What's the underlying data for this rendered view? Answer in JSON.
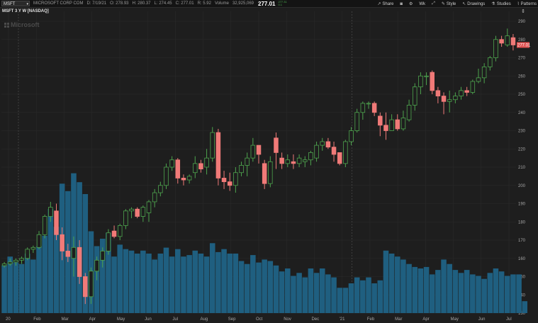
{
  "toolbar": {
    "symbol": "MSFT",
    "company": "MICROSOFT CORP COM",
    "date": "D: 7/19/21",
    "open": "O: 278.93",
    "high": "H: 280.37",
    "low": "L: 274.45",
    "close": "C: 277.01",
    "range": "R: 5.92",
    "volume_label": "Volume",
    "volume": "32,925,069",
    "last_price": "277.01",
    "change_top": "277.31",
    "change_bottom": "0.1",
    "buttons": [
      {
        "label": "Share",
        "icon": "share-icon"
      },
      {
        "label": "",
        "icon": "camera-icon"
      },
      {
        "label": "",
        "icon": "gear-icon"
      },
      {
        "label": "Wk",
        "icon": ""
      },
      {
        "label": "",
        "icon": "fullscreen-icon"
      },
      {
        "label": "Style",
        "icon": "paintbrush-icon"
      },
      {
        "label": "Drawings",
        "icon": "pencil-icon"
      },
      {
        "label": "Studies",
        "icon": "flask-icon"
      },
      {
        "label": "Patterns",
        "icon": "pattern-icon"
      }
    ]
  },
  "chart_title": "MSFT 3 Y W [NASDAQ]",
  "watermark": "Microsoft",
  "colors": {
    "up": "#4ea44e",
    "down": "#f07a78",
    "volume": "#1f5f80",
    "grid": "#2a2a2a",
    "background": "#1e1e1e",
    "price_badge": "#e05050"
  },
  "chart_data": {
    "type": "candlestick",
    "title": "MSFT 3 Y W [NASDAQ]",
    "price_axis": {
      "min": 130,
      "max": 290,
      "ticks": [
        130,
        140,
        150,
        160,
        170,
        180,
        190,
        200,
        210,
        220,
        230,
        240,
        250,
        260,
        270,
        280,
        290
      ]
    },
    "current_price_label": "277.01",
    "x_tick_labels": [
      "20",
      "Feb",
      "Mar",
      "Apr",
      "May",
      "Jun",
      "Jul",
      "Aug",
      "Sep",
      "Oct",
      "Nov",
      "Dec",
      "'21",
      "Feb",
      "Mar",
      "Apr",
      "May",
      "Jun",
      "Jul"
    ],
    "candles": [
      {
        "o": 156,
        "h": 158,
        "l": 155,
        "c": 157
      },
      {
        "o": 157,
        "h": 160,
        "l": 156,
        "c": 158
      },
      {
        "o": 158,
        "h": 160,
        "l": 156,
        "c": 159
      },
      {
        "o": 159,
        "h": 161,
        "l": 157,
        "c": 160
      },
      {
        "o": 160,
        "h": 166,
        "l": 159,
        "c": 165
      },
      {
        "o": 165,
        "h": 167,
        "l": 163,
        "c": 166
      },
      {
        "o": 166,
        "h": 175,
        "l": 165,
        "c": 173
      },
      {
        "o": 173,
        "h": 184,
        "l": 171,
        "c": 183
      },
      {
        "o": 183,
        "h": 191,
        "l": 180,
        "c": 188
      },
      {
        "o": 186,
        "h": 190,
        "l": 170,
        "c": 173
      },
      {
        "o": 173,
        "h": 177,
        "l": 159,
        "c": 164
      },
      {
        "o": 164,
        "h": 168,
        "l": 158,
        "c": 161
      },
      {
        "o": 160,
        "h": 172,
        "l": 150,
        "c": 166
      },
      {
        "o": 166,
        "h": 170,
        "l": 146,
        "c": 150
      },
      {
        "o": 150,
        "h": 152,
        "l": 135,
        "c": 139
      },
      {
        "o": 139,
        "h": 155,
        "l": 135,
        "c": 153
      },
      {
        "o": 153,
        "h": 161,
        "l": 148,
        "c": 159
      },
      {
        "o": 159,
        "h": 166,
        "l": 155,
        "c": 164
      },
      {
        "o": 164,
        "h": 176,
        "l": 162,
        "c": 174
      },
      {
        "o": 175,
        "h": 178,
        "l": 171,
        "c": 172
      },
      {
        "o": 172,
        "h": 179,
        "l": 170,
        "c": 178
      },
      {
        "o": 178,
        "h": 187,
        "l": 176,
        "c": 186
      },
      {
        "o": 186,
        "h": 188,
        "l": 182,
        "c": 187
      },
      {
        "o": 187,
        "h": 188,
        "l": 182,
        "c": 183
      },
      {
        "o": 183,
        "h": 189,
        "l": 180,
        "c": 188
      },
      {
        "o": 185,
        "h": 192,
        "l": 180,
        "c": 191
      },
      {
        "o": 191,
        "h": 198,
        "l": 188,
        "c": 196
      },
      {
        "o": 196,
        "h": 202,
        "l": 194,
        "c": 200
      },
      {
        "o": 200,
        "h": 212,
        "l": 198,
        "c": 210
      },
      {
        "o": 210,
        "h": 216,
        "l": 208,
        "c": 214
      },
      {
        "o": 214,
        "h": 215,
        "l": 201,
        "c": 204
      },
      {
        "o": 204,
        "h": 206,
        "l": 200,
        "c": 203
      },
      {
        "o": 203,
        "h": 206,
        "l": 201,
        "c": 205
      },
      {
        "o": 207,
        "h": 216,
        "l": 204,
        "c": 212
      },
      {
        "o": 212,
        "h": 214,
        "l": 207,
        "c": 209
      },
      {
        "o": 210,
        "h": 220,
        "l": 206,
        "c": 215
      },
      {
        "o": 215,
        "h": 232,
        "l": 213,
        "c": 229
      },
      {
        "o": 229,
        "h": 231,
        "l": 200,
        "c": 204
      },
      {
        "o": 204,
        "h": 208,
        "l": 198,
        "c": 202
      },
      {
        "o": 202,
        "h": 207,
        "l": 197,
        "c": 200
      },
      {
        "o": 200,
        "h": 210,
        "l": 196,
        "c": 207
      },
      {
        "o": 207,
        "h": 213,
        "l": 205,
        "c": 211
      },
      {
        "o": 211,
        "h": 218,
        "l": 205,
        "c": 215
      },
      {
        "o": 215,
        "h": 226,
        "l": 213,
        "c": 222
      },
      {
        "o": 222,
        "h": 222,
        "l": 212,
        "c": 217
      },
      {
        "o": 212,
        "h": 214,
        "l": 198,
        "c": 201
      },
      {
        "o": 201,
        "h": 216,
        "l": 199,
        "c": 213
      },
      {
        "o": 226,
        "h": 229,
        "l": 209,
        "c": 218
      },
      {
        "o": 215,
        "h": 218,
        "l": 209,
        "c": 212
      },
      {
        "o": 212,
        "h": 217,
        "l": 210,
        "c": 214
      },
      {
        "o": 213,
        "h": 217,
        "l": 209,
        "c": 212
      },
      {
        "o": 212,
        "h": 217,
        "l": 210,
        "c": 215
      },
      {
        "o": 213,
        "h": 216,
        "l": 210,
        "c": 214
      },
      {
        "o": 214,
        "h": 219,
        "l": 211,
        "c": 218
      },
      {
        "o": 215,
        "h": 224,
        "l": 213,
        "c": 222
      },
      {
        "o": 222,
        "h": 226,
        "l": 219,
        "c": 224
      },
      {
        "o": 224,
        "h": 226,
        "l": 220,
        "c": 221
      },
      {
        "o": 221,
        "h": 224,
        "l": 213,
        "c": 217
      },
      {
        "o": 218,
        "h": 218,
        "l": 211,
        "c": 212
      },
      {
        "o": 212,
        "h": 225,
        "l": 210,
        "c": 224
      },
      {
        "o": 224,
        "h": 232,
        "l": 222,
        "c": 230
      },
      {
        "o": 230,
        "h": 242,
        "l": 229,
        "c": 240
      },
      {
        "o": 240,
        "h": 246,
        "l": 236,
        "c": 245
      },
      {
        "o": 245,
        "h": 246,
        "l": 242,
        "c": 245
      },
      {
        "o": 245,
        "h": 246,
        "l": 238,
        "c": 240
      },
      {
        "o": 238,
        "h": 240,
        "l": 227,
        "c": 233
      },
      {
        "o": 233,
        "h": 240,
        "l": 225,
        "c": 230
      },
      {
        "o": 230,
        "h": 239,
        "l": 230,
        "c": 236
      },
      {
        "o": 236,
        "h": 239,
        "l": 230,
        "c": 231
      },
      {
        "o": 231,
        "h": 241,
        "l": 230,
        "c": 237
      },
      {
        "o": 236,
        "h": 247,
        "l": 235,
        "c": 244
      },
      {
        "o": 244,
        "h": 256,
        "l": 241,
        "c": 254
      },
      {
        "o": 254,
        "h": 262,
        "l": 250,
        "c": 260
      },
      {
        "o": 260,
        "h": 262,
        "l": 255,
        "c": 260
      },
      {
        "o": 262,
        "h": 263,
        "l": 250,
        "c": 252
      },
      {
        "o": 252,
        "h": 254,
        "l": 245,
        "c": 249
      },
      {
        "o": 249,
        "h": 251,
        "l": 239,
        "c": 246
      },
      {
        "o": 246,
        "h": 252,
        "l": 240,
        "c": 247
      },
      {
        "o": 247,
        "h": 251,
        "l": 245,
        "c": 249
      },
      {
        "o": 249,
        "h": 254,
        "l": 247,
        "c": 252
      },
      {
        "o": 252,
        "h": 254,
        "l": 249,
        "c": 251
      },
      {
        "o": 251,
        "h": 258,
        "l": 250,
        "c": 257
      },
      {
        "o": 257,
        "h": 264,
        "l": 256,
        "c": 259
      },
      {
        "o": 259,
        "h": 267,
        "l": 256,
        "c": 265
      },
      {
        "o": 265,
        "h": 271,
        "l": 263,
        "c": 270
      },
      {
        "o": 270,
        "h": 282,
        "l": 268,
        "c": 280
      },
      {
        "o": 280,
        "h": 282,
        "l": 276,
        "c": 278
      },
      {
        "o": 277,
        "h": 286,
        "l": 276,
        "c": 282
      },
      {
        "o": 281,
        "h": 283,
        "l": 274,
        "c": 277
      }
    ],
    "volume_relative": [
      0.32,
      0.38,
      0.34,
      0.33,
      0.4,
      0.36,
      0.45,
      0.52,
      0.7,
      0.58,
      0.87,
      0.82,
      0.94,
      0.88,
      0.8,
      0.55,
      0.45,
      0.5,
      0.54,
      0.38,
      0.46,
      0.43,
      0.42,
      0.4,
      0.42,
      0.4,
      0.36,
      0.4,
      0.44,
      0.38,
      0.43,
      0.38,
      0.39,
      0.42,
      0.4,
      0.38,
      0.47,
      0.41,
      0.43,
      0.4,
      0.4,
      0.35,
      0.33,
      0.39,
      0.34,
      0.36,
      0.35,
      0.32,
      0.28,
      0.3,
      0.25,
      0.27,
      0.24,
      0.3,
      0.27,
      0.3,
      0.26,
      0.24,
      0.17,
      0.17,
      0.2,
      0.24,
      0.22,
      0.24,
      0.2,
      0.22,
      0.42,
      0.4,
      0.38,
      0.36,
      0.33,
      0.31,
      0.3,
      0.31,
      0.26,
      0.29,
      0.36,
      0.33,
      0.29,
      0.27,
      0.29,
      0.26,
      0.25,
      0.23,
      0.27,
      0.3,
      0.28,
      0.25,
      0.26,
      0.26,
      0.08
    ]
  }
}
